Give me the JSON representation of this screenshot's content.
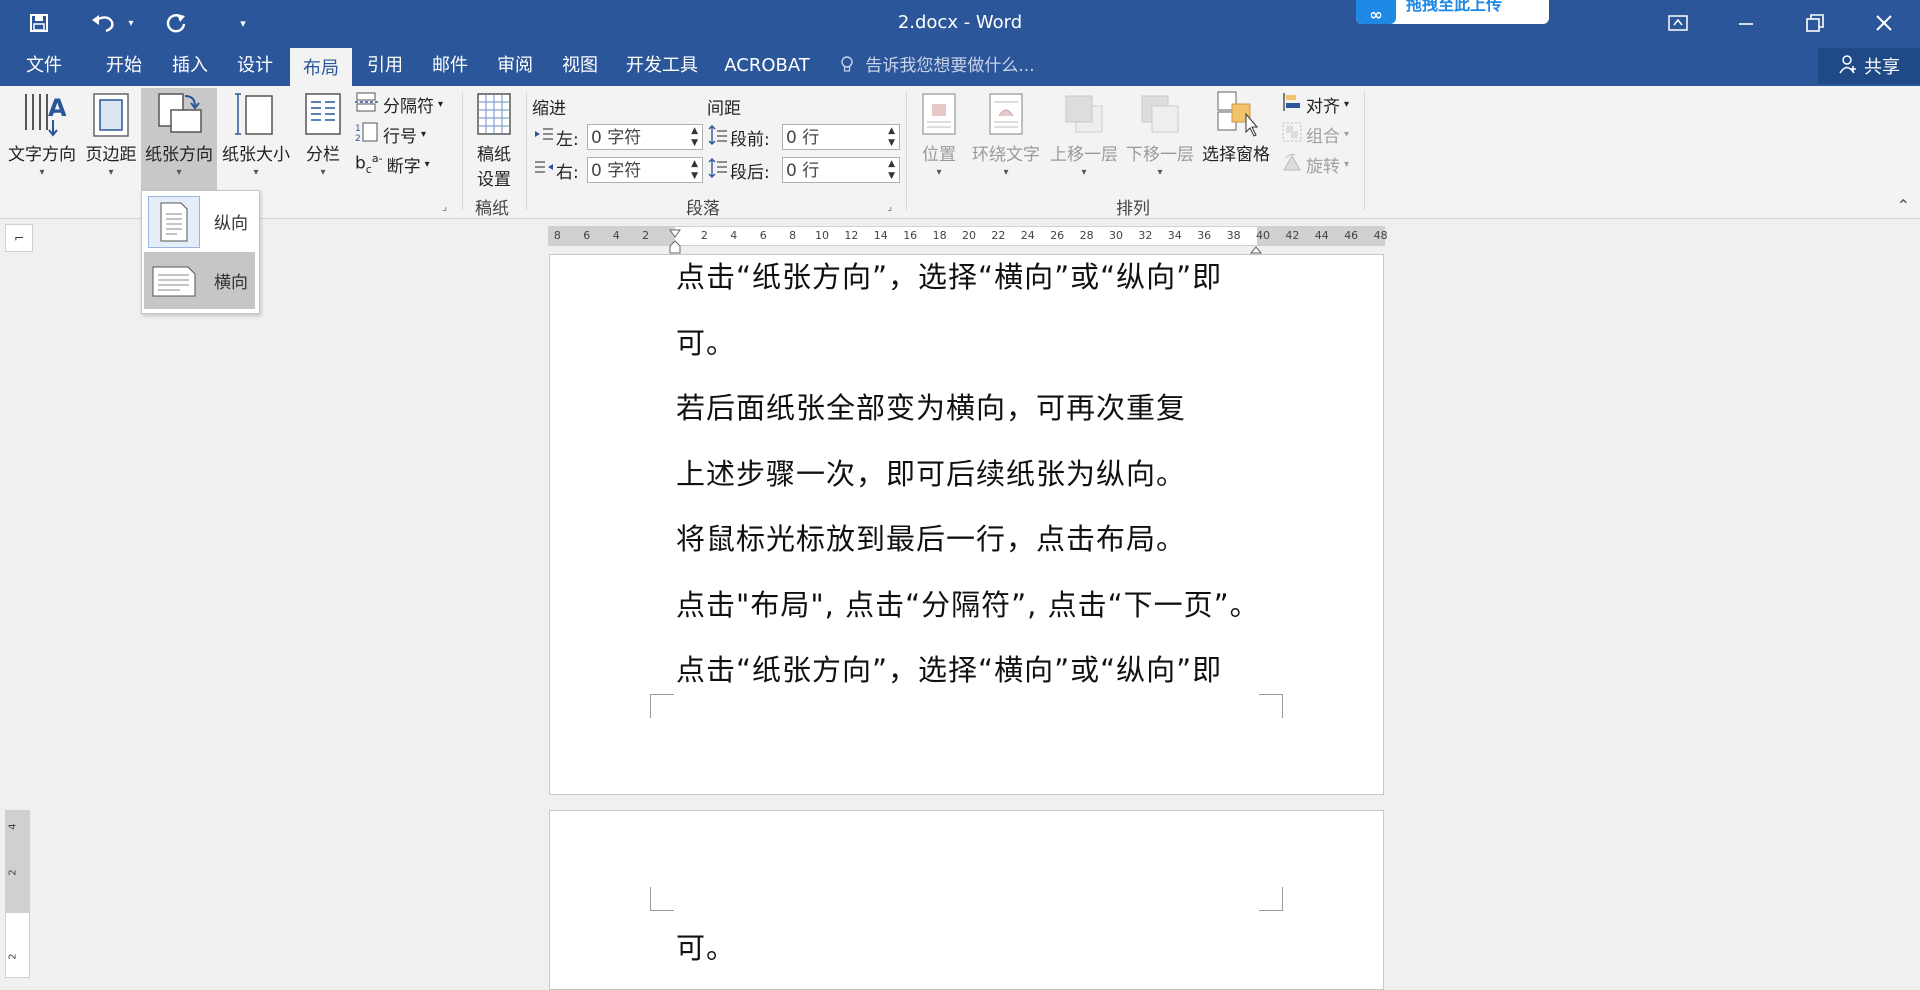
{
  "titlebar": {
    "title": "2.docx - Word",
    "cloud_label": "拖拽至此上传",
    "qat": {
      "save": "save-icon",
      "undo": "undo-icon",
      "redo": "redo-icon",
      "customize": "customize-qat-icon"
    }
  },
  "tabs": [
    "文件",
    "开始",
    "插入",
    "设计",
    "布局",
    "引用",
    "邮件",
    "审阅",
    "视图",
    "开发工具",
    "ACROBAT"
  ],
  "active_tab": "布局",
  "tell_me": "告诉我您想要做什么...",
  "share": "共享",
  "ribbon": {
    "page_setup": {
      "text_direction": "文字方向",
      "margins": "页边距",
      "orientation": "纸张方向",
      "size": "纸张大小",
      "columns": "分栏",
      "breaks": "分隔符",
      "line_numbers": "行号",
      "hyphenation": "断字"
    },
    "manuscript": {
      "button": "稿纸\n设置",
      "button_line1": "稿纸",
      "button_line2": "设置",
      "group": "稿纸"
    },
    "paragraph": {
      "indent_label": "缩进",
      "spacing_label": "间距",
      "left_label": "左:",
      "right_label": "右:",
      "left_value": "0 字符",
      "right_value": "0 字符",
      "before_label": "段前:",
      "after_label": "段后:",
      "before_value": "0 行",
      "after_value": "0 行",
      "group": "段落"
    },
    "arrange": {
      "position": "位置",
      "wrap_text": "环绕文字",
      "bring_forward": "上移一层",
      "send_backward": "下移一层",
      "selection_pane": "选择窗格",
      "align": "对齐",
      "group_btn": "组合",
      "rotate": "旋转",
      "group": "排列"
    }
  },
  "orientation_menu": {
    "portrait": "纵向",
    "landscape": "横向",
    "selected": "横向"
  },
  "ruler": {
    "ticks": [
      "8",
      "6",
      "4",
      "2",
      "2",
      "4",
      "6",
      "8",
      "10",
      "12",
      "14",
      "16",
      "18",
      "20",
      "22",
      "24",
      "26",
      "28",
      "30",
      "32",
      "34",
      "36",
      "38",
      "40",
      "42",
      "44",
      "46",
      "48"
    ],
    "vticks": [
      "4",
      "2",
      "2"
    ]
  },
  "document": {
    "page1_lines": [
      "点击“纸张方向”，选择“横向”或“纵向”即",
      "可。",
      "若后面纸张全部变为横向，可再次重复",
      "上述步骤一次，即可后续纸张为纵向。",
      "将鼠标光标放到最后一行，点击布局。",
      "点击\"布局\", 点击“分隔符”, 点击“下一页”。",
      "点击“纸张方向”，选择“横向”或“纵向”即"
    ],
    "page2_lines": [
      "可。"
    ]
  }
}
